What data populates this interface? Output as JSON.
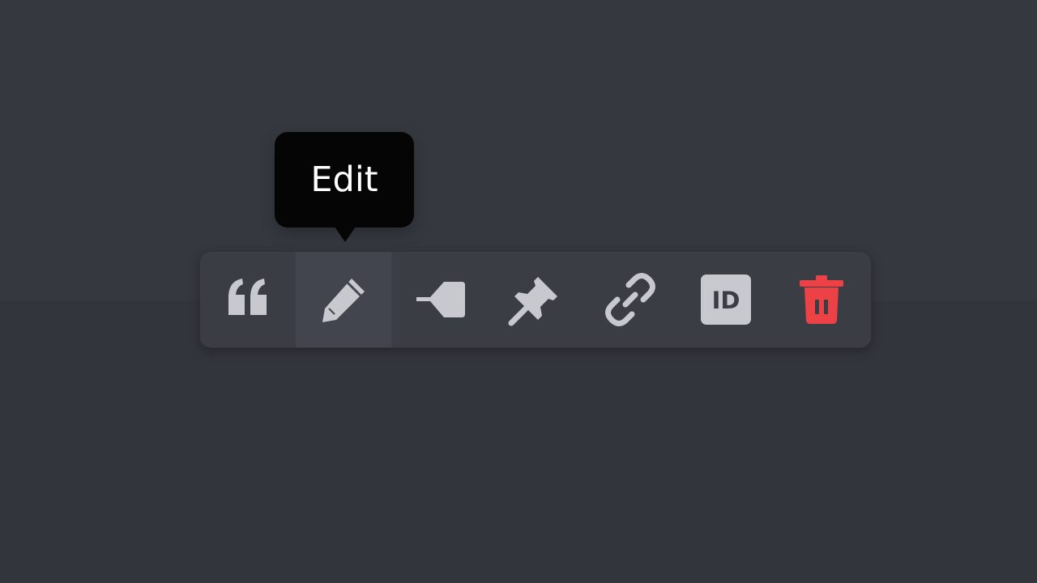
{
  "tooltip": {
    "text": "Edit"
  },
  "toolbar": {
    "items": [
      {
        "icon": "quote-icon",
        "action": "quote"
      },
      {
        "icon": "pencil-icon",
        "action": "edit",
        "active": true
      },
      {
        "icon": "reply-icon",
        "action": "reply"
      },
      {
        "icon": "pin-icon",
        "action": "pin"
      },
      {
        "icon": "link-icon",
        "action": "copy-link"
      },
      {
        "icon": "id-icon",
        "action": "copy-id",
        "label": "ID"
      },
      {
        "icon": "trash-icon",
        "action": "delete"
      }
    ]
  },
  "colors": {
    "background": "#363840",
    "toolbar": "#3b3d45",
    "active_button": "#43454e",
    "icon": "#c8c9cf",
    "danger": "#ed4245",
    "tooltip": "#050505",
    "tooltip_text": "#ffffff"
  }
}
